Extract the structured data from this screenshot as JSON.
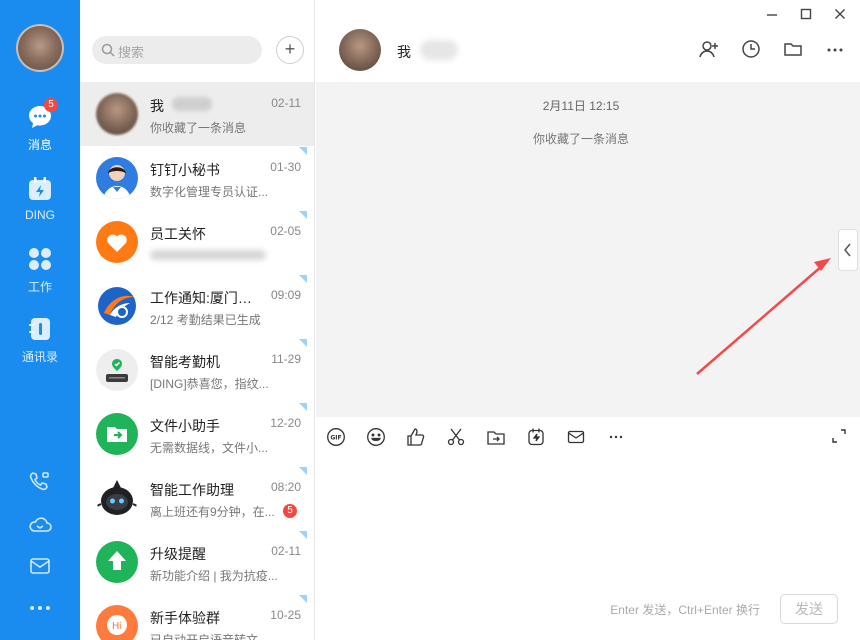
{
  "nav": {
    "items": [
      {
        "label": "消息",
        "icon": "chat-bubble-icon",
        "badge": "5"
      },
      {
        "label": "DING",
        "icon": "ding-icon"
      },
      {
        "label": "工作",
        "icon": "apps-grid-icon"
      },
      {
        "label": "通讯录",
        "icon": "contacts-book-icon"
      }
    ],
    "bottom_icons": [
      "video-call-icon",
      "cloud-icon",
      "mail-icon",
      "more-dots-icon"
    ]
  },
  "list": {
    "search_placeholder": "搜索",
    "add_label": "+",
    "conversations": [
      {
        "name": "我",
        "time": "02-11",
        "preview": "你收藏了一条消息"
      },
      {
        "name": "钉钉小秘书",
        "time": "01-30",
        "preview": "数字化管理专员认证..."
      },
      {
        "name": "员工关怀",
        "time": "02-05",
        "preview": ""
      },
      {
        "name": "工作通知:厦门博...",
        "time": "09:09",
        "preview": "2/12 考勤结果已生成"
      },
      {
        "name": "智能考勤机",
        "time": "11-29",
        "preview": "[DING]恭喜您，指纹..."
      },
      {
        "name": "文件小助手",
        "time": "12-20",
        "preview": "无需数据线，文件小..."
      },
      {
        "name": "智能工作助理",
        "time": "08:20",
        "preview": "离上班还有9分钟，在...",
        "badge": "5"
      },
      {
        "name": "升级提醒",
        "time": "02-11",
        "preview": "新功能介绍 | 我为抗疫..."
      },
      {
        "name": "新手体验群",
        "time": "10-25",
        "preview": "已自动开启语音转文..."
      }
    ]
  },
  "chat": {
    "title": "我",
    "timestamp": "2月11日 12:15",
    "system_message": "你收藏了一条消息",
    "input_hint": "Enter 发送，Ctrl+Enter 换行",
    "send_label": "发送"
  },
  "colors": {
    "nav_bg": "#1a8cf0",
    "badge": "#f5473f",
    "arrow": "#f04a4a"
  }
}
